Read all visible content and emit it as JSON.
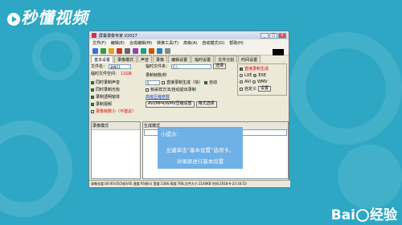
{
  "brand": {
    "logo_text": "秒懂视频"
  },
  "watermark": {
    "text_before": "Bai",
    "text_after": "经验"
  },
  "window": {
    "title": "屏幕录像专家 V2017",
    "controls": [
      "_",
      "□",
      "x"
    ],
    "menu": [
      "文件(F)",
      "编辑(E)",
      "合成编辑(M)",
      "转换工具(T)",
      "高级(A)",
      "自动模式(O)",
      "帮助(H)"
    ],
    "tabs": [
      "基本设置",
      "录像模式",
      "声音",
      "录像",
      "编辑设置",
      "临时设置",
      "文件分割",
      "时间设置"
    ],
    "left_panel": {
      "filename_label": "文件名：",
      "filename_value": "录像11",
      "disk_label": "临时文件空间：",
      "disk_value": "11GB",
      "options": [
        {
          "label": "同时录制声音",
          "checked": true
        },
        {
          "label": "同时录制光标",
          "checked": true
        },
        {
          "label": "录制透明窗体",
          "checked": true
        },
        {
          "label": "录制视频",
          "checked": true
        }
      ],
      "red_option": "录像帧数小（不建议）"
    },
    "mid_panel": {
      "path_label": "临时文件夹：",
      "path_value": "C:\\...",
      "browse_button": "选择",
      "fps_label": "录制帧数/秒",
      "fps_value": "5",
      "auto_label": "自动",
      "option1": "直接录制生成（快）",
      "option2": "帧采样方法/自动退出录制",
      "link": "高级压缩参数",
      "btn_a": "AVI/MP4/WMV压缩设置",
      "btn_b": "格式选择"
    },
    "right_panel": {
      "title": "直接录制生成",
      "opt_lxe": "LXE",
      "opt_exe": "EXE",
      "opt_avi": "AVI",
      "opt_wmv": "WMV",
      "opt_other": "自定义",
      "settings_button": "设置"
    },
    "list_header": "录像模式",
    "right_header": "生成模式",
    "status": "录像长度:00:00:05(5帧)/45 速度:95帧(s) 宽度:1366 高度:768,文件大小:1140KB 时间:2018-6-23 16:53"
  },
  "tip": {
    "title": "小提示：",
    "line1": "左键单击“基本设置”选项卡，",
    "line2": "对录屏进行基本设置"
  },
  "colors": {
    "background": "#2ea7c5",
    "tip_background": "#6fb0e6",
    "window_face": "#ece9d8"
  }
}
